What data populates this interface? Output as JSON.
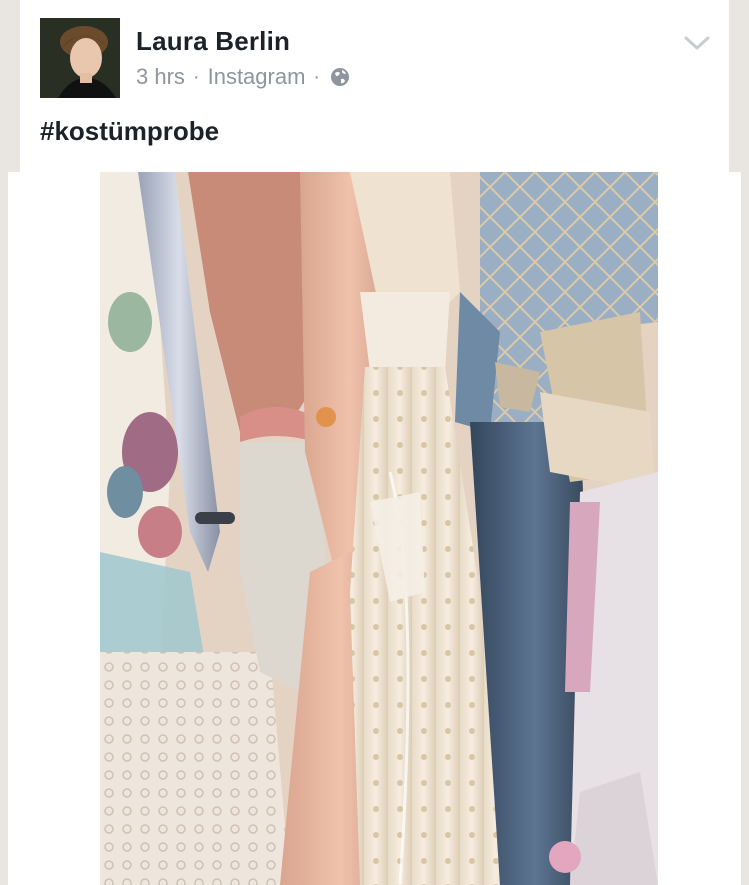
{
  "post": {
    "author": "Laura Berlin",
    "time": "3 hrs",
    "separator": "·",
    "source": "Instagram",
    "privacy_icon": "globe-icon",
    "caption": "#kostümprobe"
  },
  "menu_icon": "chevron-down-icon",
  "colors": {
    "background": "#e9e6e2",
    "card": "#ffffff",
    "author_text": "#1d2129",
    "meta_text": "#90949c"
  }
}
